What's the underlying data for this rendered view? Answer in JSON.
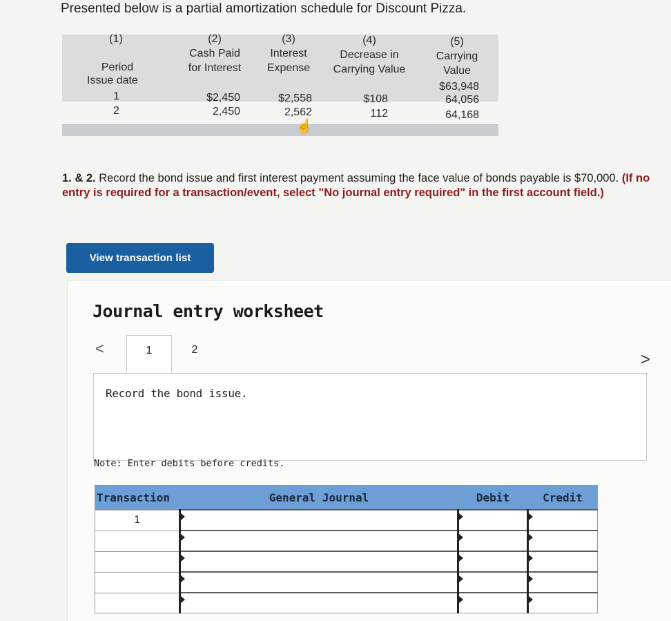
{
  "intro": "Presented below is a partial amortization schedule for Discount Pizza.",
  "schedule": {
    "col1": {
      "num": "(1)",
      "label": "Period"
    },
    "col2": {
      "num": "(2)",
      "line1": "Cash Paid",
      "line2": "for Interest"
    },
    "col3": {
      "num": "(3)",
      "line1": "Interest",
      "line2": "Expense"
    },
    "col4": {
      "num": "(4)",
      "line1": "Decrease in",
      "line2": "Carrying Value"
    },
    "col5": {
      "num": "(5)",
      "line1": "Carrying",
      "line2": "Value"
    },
    "rows": [
      {
        "period": "Issue date",
        "cash": "",
        "interest": "",
        "decrease": "",
        "carrying": "$63,948"
      },
      {
        "period": "1",
        "cash": "$2,450",
        "interest": "$2,558",
        "decrease": "$108",
        "carrying": "64,056"
      },
      {
        "period": "2",
        "cash": "2,450",
        "interest": "2,562",
        "decrease": "112",
        "carrying": "64,168"
      }
    ]
  },
  "question": {
    "prefix": "1. & 2.",
    "text": " Record the bond issue and first interest payment assuming the face value of bonds payable is $70,000.",
    "instruction": " (If no entry is required for a transaction/event, select \"No journal entry required\" in the first account field.)"
  },
  "view_button": "View transaction list",
  "worksheet": {
    "title": "Journal entry worksheet",
    "prev": "<",
    "next": ">",
    "tabs": [
      "1",
      "2"
    ],
    "entry_text": "Record the bond issue.",
    "note": "Note: Enter debits before credits."
  },
  "journal": {
    "headers": {
      "transaction": "Transaction",
      "general": "General Journal",
      "debit": "Debit",
      "credit": "Credit"
    },
    "rows": [
      "1",
      "",
      "",
      "",
      ""
    ]
  }
}
